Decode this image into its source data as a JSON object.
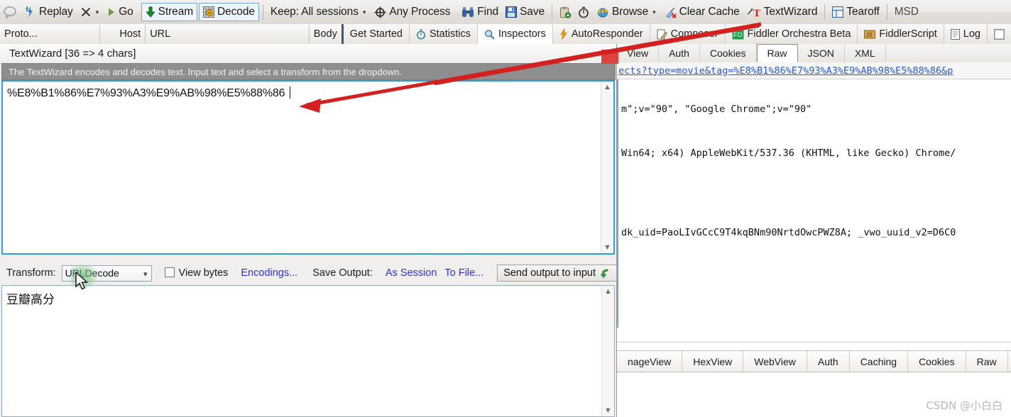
{
  "toolbar": {
    "items": [
      {
        "name": "comment-icon",
        "label": "",
        "icon": "speech-bubble"
      },
      {
        "name": "replay",
        "label": "Replay",
        "icon": "replay-lightning"
      },
      {
        "name": "remove",
        "label": "",
        "icon": "x-mark"
      },
      {
        "name": "go",
        "label": "Go",
        "icon": "play-triangle"
      },
      {
        "name": "stream",
        "label": "Stream",
        "icon": "down-arrow-green"
      },
      {
        "name": "decode",
        "label": "Decode",
        "icon": "grid-gear"
      },
      {
        "name": "keep",
        "label": "Keep: All sessions",
        "icon": ""
      },
      {
        "name": "any-process",
        "label": "Any Process",
        "icon": "crosshair"
      },
      {
        "name": "find",
        "label": "Find",
        "icon": "binoculars"
      },
      {
        "name": "save",
        "label": "Save",
        "icon": "floppy-blue"
      },
      {
        "name": "clipboard",
        "label": "",
        "icon": "clipboard"
      },
      {
        "name": "timer",
        "label": "",
        "icon": "stopwatch"
      },
      {
        "name": "browse",
        "label": "Browse",
        "icon": "ie-globe"
      },
      {
        "name": "clear-cache",
        "label": "Clear Cache",
        "icon": "broom-red"
      },
      {
        "name": "textwizard",
        "label": "TextWizard",
        "icon": "T-red"
      },
      {
        "name": "tearoff",
        "label": "Tearoff",
        "icon": "window-split"
      },
      {
        "name": "msdn",
        "label": "MSD",
        "icon": ""
      }
    ]
  },
  "columns": {
    "proto": "Proto...",
    "host": "Host",
    "url": "URL",
    "body": "Body"
  },
  "main_tabs": [
    {
      "label": "Get Started",
      "icon": ""
    },
    {
      "label": "Statistics",
      "icon": "stopwatch"
    },
    {
      "label": "Inspectors",
      "icon": "magnifier"
    },
    {
      "label": "AutoResponder",
      "icon": "bolt"
    },
    {
      "label": "Composer",
      "icon": "pencil-note"
    },
    {
      "label": "Fiddler Orchestra Beta",
      "icon": "fo-badge"
    },
    {
      "label": "FiddlerScript",
      "icon": "js-badge"
    },
    {
      "label": "Log",
      "icon": "log-page"
    },
    {
      "label": "",
      "icon": "checkbox"
    }
  ],
  "textwizard": {
    "title": "TextWizard [36 => 4 chars]",
    "hint": "The TextWizard encodes and decodes text. Input text and select a transform from the dropdown.",
    "input_value": "%E8%B1%86%E7%93%A3%E9%AB%98%E5%88%86",
    "transform_label": "Transform:",
    "transform_value": "URLDecode",
    "view_bytes_label": "View bytes",
    "encodings_label": "Encodings...",
    "save_output_label": "Save Output:",
    "as_session_label": "As Session",
    "to_file_label": "To File...",
    "send_output_label": "Send output to input",
    "output_value": "豆瓣高分"
  },
  "inspector": {
    "tabs": [
      {
        "label": "View",
        "selected": false
      },
      {
        "label": "Auth",
        "selected": false
      },
      {
        "label": "Cookies",
        "selected": false
      },
      {
        "label": "Raw",
        "selected": true
      },
      {
        "label": "JSON",
        "selected": false
      },
      {
        "label": "XML",
        "selected": false
      }
    ],
    "url_fragment": "ects?type=movie&tag=%E8%B1%86%E7%93%A3%E9%AB%98%E5%88%86&p",
    "header_lines": [
      "m\";v=\"90\", \"Google Chrome\";v=\"90\"",
      "Win64; x64) AppleWebKit/537.36 (KHTML, like Gecko) Chrome/",
      "dk_uid=PaoLIvGCcC9T4kqBNm90NrtdOwcPWZ8A; _vwo_uuid_v2=D6C0"
    ],
    "bottom_tabs": [
      {
        "label": "nageView"
      },
      {
        "label": "HexView"
      },
      {
        "label": "WebView"
      },
      {
        "label": "Auth"
      },
      {
        "label": "Caching"
      },
      {
        "label": "Cookies"
      },
      {
        "label": "Raw"
      }
    ]
  },
  "annotations": {
    "arrow_color": "#d32020",
    "marker_color": "#d9443c"
  },
  "watermark": "CSDN @小白白"
}
